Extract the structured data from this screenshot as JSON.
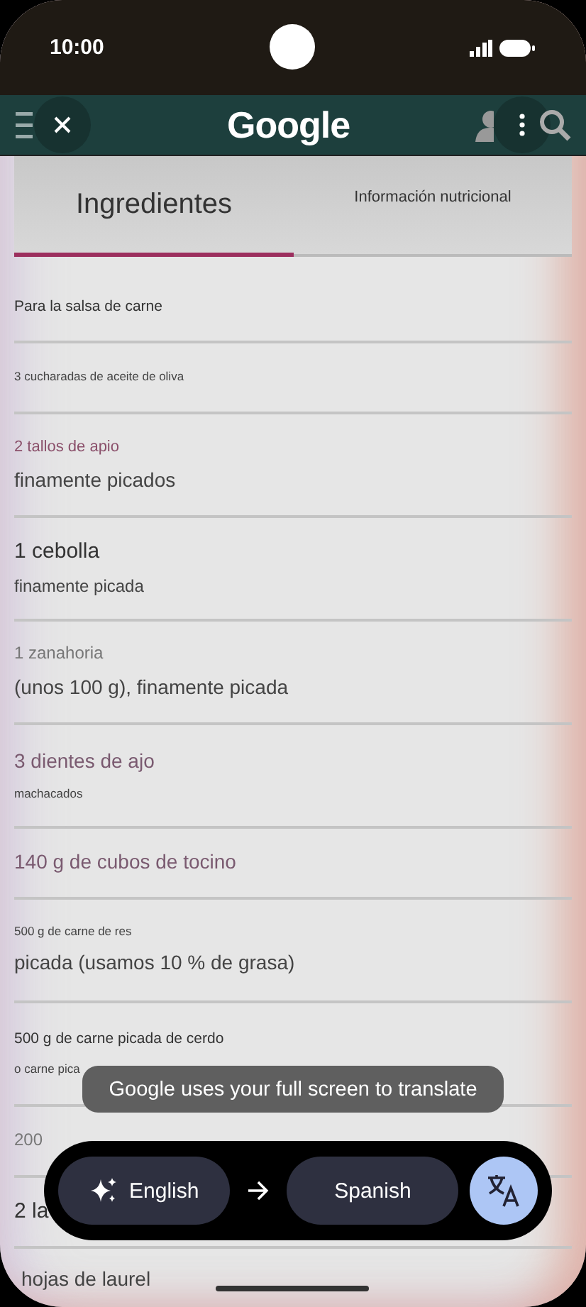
{
  "status_bar": {
    "time": "10:00"
  },
  "header": {
    "logo": "Google"
  },
  "tabs": [
    {
      "label": "Ingredientes",
      "selected": true
    },
    {
      "label": "Información nutricional",
      "selected": false
    }
  ],
  "ingredients": [
    {
      "lines": [
        {
          "text": "Para la salsa de carne",
          "kind": "small"
        }
      ]
    },
    {
      "lines": [
        {
          "text": "3 cucharadas de aceite de oliva",
          "kind": "tiny"
        }
      ]
    },
    {
      "lines": [
        {
          "text": "2 tallos de apio",
          "kind": "accent"
        },
        {
          "text": "finamente picados",
          "kind": "body"
        }
      ]
    },
    {
      "lines": [
        {
          "text": "1 cebolla",
          "kind": "large"
        },
        {
          "text": "finamente picada",
          "kind": "note"
        }
      ]
    },
    {
      "lines": [
        {
          "text": "1 zanahoria",
          "kind": "muted"
        },
        {
          "text": "(unos 100 g), finamente picada",
          "kind": "body"
        }
      ]
    },
    {
      "lines": [
        {
          "text": "3 dientes de ajo",
          "kind": "heading"
        },
        {
          "text": "machacados",
          "kind": "tiny"
        }
      ]
    },
    {
      "lines": [
        {
          "text": "140 g de cubos de tocino",
          "kind": "heading"
        }
      ]
    },
    {
      "lines": [
        {
          "text": "500 g de carne de res",
          "kind": "tiny"
        },
        {
          "text": "picada (usamos 10 % de grasa)",
          "kind": "body"
        }
      ]
    },
    {
      "lines": [
        {
          "text": "500 g de carne picada de cerdo",
          "kind": "small"
        },
        {
          "text": "o carne pica",
          "kind": "tiny"
        }
      ]
    },
    {
      "lines": [
        {
          "text": "200",
          "kind": "muted"
        }
      ]
    },
    {
      "lines": [
        {
          "text": "2 la",
          "kind": "large"
        }
      ]
    },
    {
      "lines": [
        {
          "text": "hojas de laurel",
          "kind": "body"
        }
      ]
    }
  ],
  "toast": {
    "text": "Google uses your full screen to translate"
  },
  "translate_bar": {
    "source": "English",
    "target": "Spanish"
  }
}
